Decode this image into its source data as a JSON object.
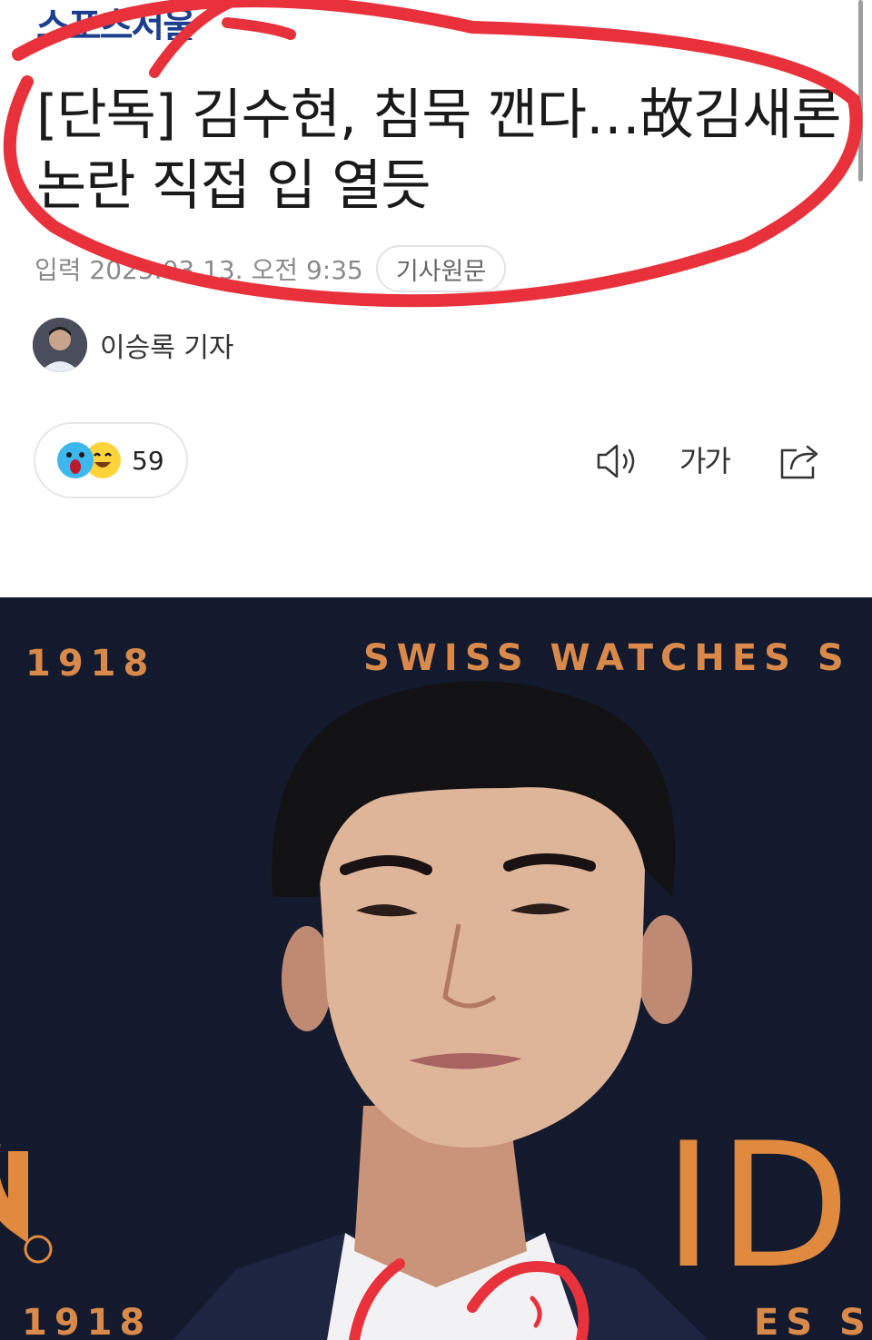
{
  "publication": {
    "logo_text": "스포츠서울"
  },
  "article": {
    "headline_line1": "[단독] 김수현, 침묵 깬다…故김새론",
    "headline_line2": "논란 직접 입 열듯",
    "published_label": "입력 2025.03.13. 오전 9:35",
    "original_link_label": "기사원문",
    "author": "이승록 기자"
  },
  "reactions": {
    "count": "59",
    "icons": [
      "shocked-emoji-icon",
      "smile-emoji-icon"
    ]
  },
  "toolbar": {
    "speaker_icon": "speaker-icon",
    "font_size_label": "가가",
    "share_icon": "share-icon"
  },
  "photo": {
    "backdrop_text_top_left": "1918",
    "backdrop_text_top_right": "SWISS WATCHES S",
    "backdrop_text_right": "ID",
    "backdrop_text_bottom_left": "1918",
    "backdrop_text_bottom_right": "ES S"
  },
  "colors": {
    "annotation_red": "#e8313a",
    "logo_blue": "#1b3e8f",
    "backdrop_navy": "#141a2d",
    "backdrop_orange": "#d9894a"
  }
}
